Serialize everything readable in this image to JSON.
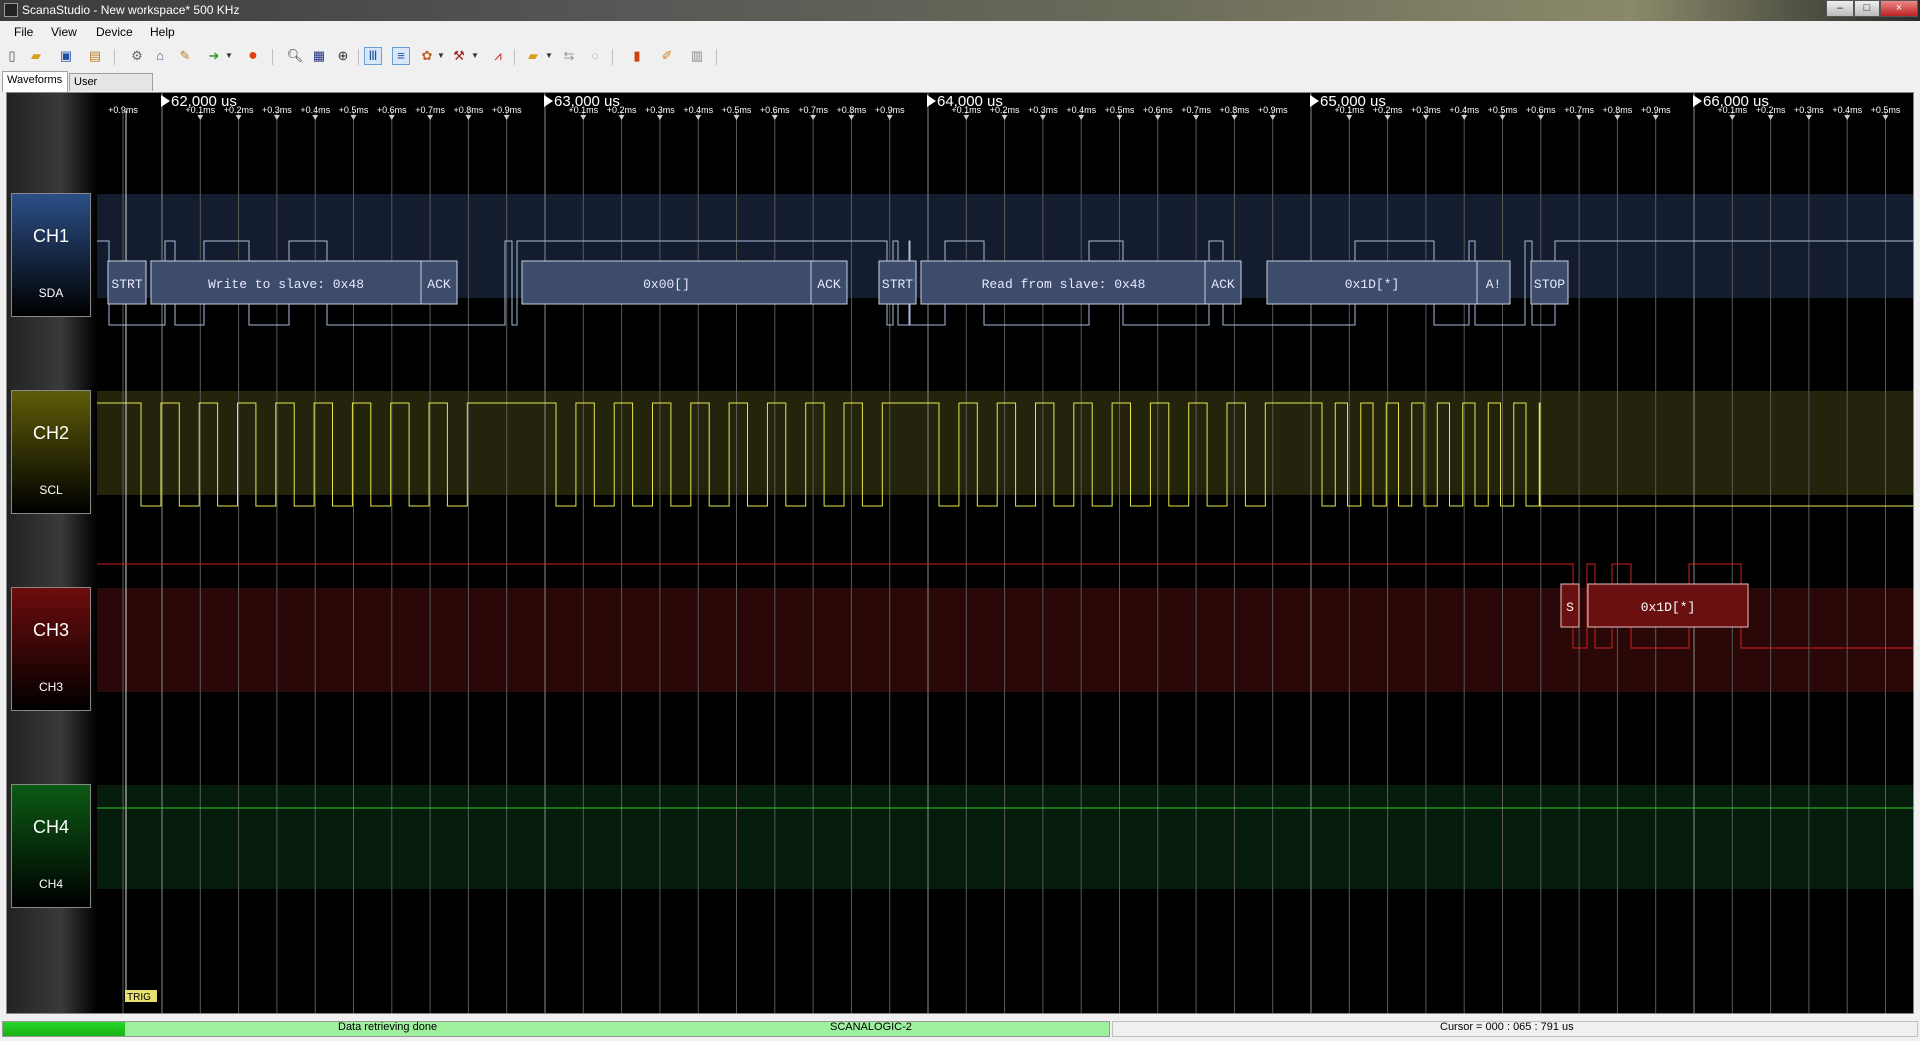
{
  "window": {
    "title": "ScanaStudio - New workspace* 500 KHz",
    "min_label": "–",
    "max_label": "□",
    "close_label": "×"
  },
  "menu": [
    "File",
    "View",
    "Device",
    "Help"
  ],
  "toolbar": {
    "icons": [
      "new-file-icon",
      "open-folder-icon",
      "save-icon",
      "save-as-icon",
      "device-settings-icon",
      "scan-icon",
      "pen-tool-icon",
      "run-arrow-icon",
      "record-icon",
      "zoom-out-icon",
      "zoom-fit-icon",
      "zoom-in-icon",
      "grid-columns-icon",
      "list-view-icon",
      "palette-icon",
      "plugin-icon",
      "waveform-analyze-icon",
      "open-file-dropdown-icon",
      "export-icon",
      "clear-icon",
      "bookmark-icon",
      "eraser-icon",
      "trash-icon"
    ]
  },
  "tabs": [
    "Waveforms",
    "User comments"
  ],
  "channels": [
    {
      "name": "CH1",
      "label": "SDA",
      "color": "#2b4f86"
    },
    {
      "name": "CH2",
      "label": "SCL",
      "color": "#5e5c08"
    },
    {
      "name": "CH3",
      "label": "CH3",
      "color": "#6e0c0c"
    },
    {
      "name": "CH4",
      "label": "CH4",
      "color": "#0c5a14"
    }
  ],
  "timeline": {
    "major_labels": [
      "62,000 us",
      "63,000 us",
      "64,000 us",
      "65,000 us",
      "66,000 us"
    ],
    "minor_labels": [
      "+0.1ms",
      "+0.2ms",
      "+0.3ms",
      "+0.4ms",
      "+0.5ms",
      "+0.6ms",
      "+0.7ms",
      "+0.8ms",
      "+0.9ms"
    ],
    "leading_label": "+0.9ms"
  },
  "decoded": {
    "ch1": [
      "STRT",
      "Write to slave: 0x48",
      "ACK",
      "0x00[]",
      "ACK",
      "STRT",
      "Read from slave: 0x48",
      "ACK",
      "0x1D[*]",
      "A!",
      "STOP"
    ],
    "ch3": [
      "S",
      "0x1D[*]"
    ]
  },
  "trigger_label": "TRIG",
  "status": {
    "progress": 0.11,
    "message": "Data retrieving done",
    "device": "SCANALOGIC-2",
    "cursor": "Cursor = 000 : 065 : 791 us"
  }
}
